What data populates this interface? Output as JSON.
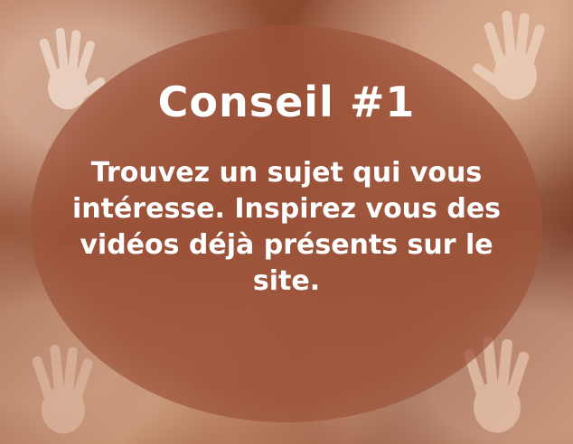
{
  "poster": {
    "title": "Conseil  #1",
    "lines": [
      "Trouvez un sujet qui vous",
      "intéresse. Inspirez vous des",
      "vidéos déjà présents sur le",
      "site."
    ]
  },
  "colors": {
    "background": "#8a4a30",
    "oval": "#96503a",
    "text": "#ffffff"
  },
  "icons": [
    "hand-stencil-icon"
  ]
}
